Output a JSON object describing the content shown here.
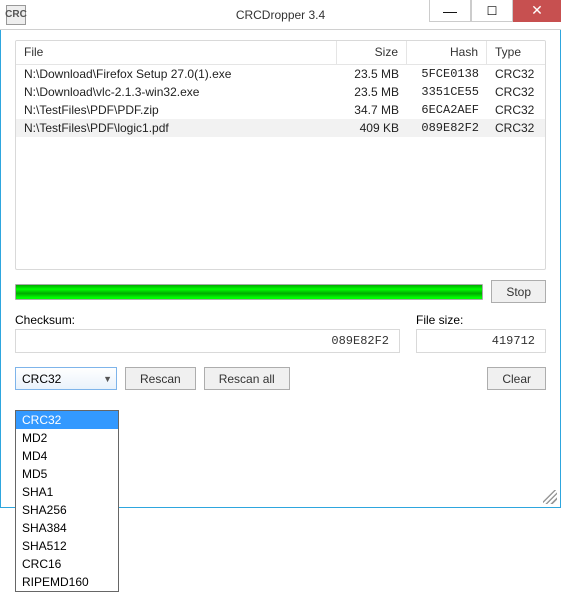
{
  "window": {
    "title": "CRCDropper 3.4",
    "icon_text": "CRC"
  },
  "columns": {
    "file": "File",
    "size": "Size",
    "hash": "Hash",
    "type": "Type"
  },
  "files": [
    {
      "path": "N:\\Download\\Firefox Setup 27.0(1).exe",
      "size": "23.5 MB",
      "hash": "5FCE0138",
      "type": "CRC32",
      "selected": false
    },
    {
      "path": "N:\\Download\\vlc-2.1.3-win32.exe",
      "size": "23.5 MB",
      "hash": "3351CE55",
      "type": "CRC32",
      "selected": false
    },
    {
      "path": "N:\\TestFiles\\PDF\\PDF.zip",
      "size": "34.7 MB",
      "hash": "6ECA2AEF",
      "type": "CRC32",
      "selected": false
    },
    {
      "path": "N:\\TestFiles\\PDF\\logic1.pdf",
      "size": "409 KB",
      "hash": "089E82F2",
      "type": "CRC32",
      "selected": true
    }
  ],
  "buttons": {
    "stop": "Stop",
    "rescan": "Rescan",
    "rescan_all": "Rescan all",
    "clear": "Clear"
  },
  "labels": {
    "checksum": "Checksum:",
    "filesize": "File size:"
  },
  "values": {
    "checksum": "089E82F2",
    "filesize": "419712"
  },
  "algo": {
    "selected": "CRC32",
    "options": [
      "CRC32",
      "MD2",
      "MD4",
      "MD5",
      "SHA1",
      "SHA256",
      "SHA384",
      "SHA512",
      "CRC16",
      "RIPEMD160"
    ]
  }
}
